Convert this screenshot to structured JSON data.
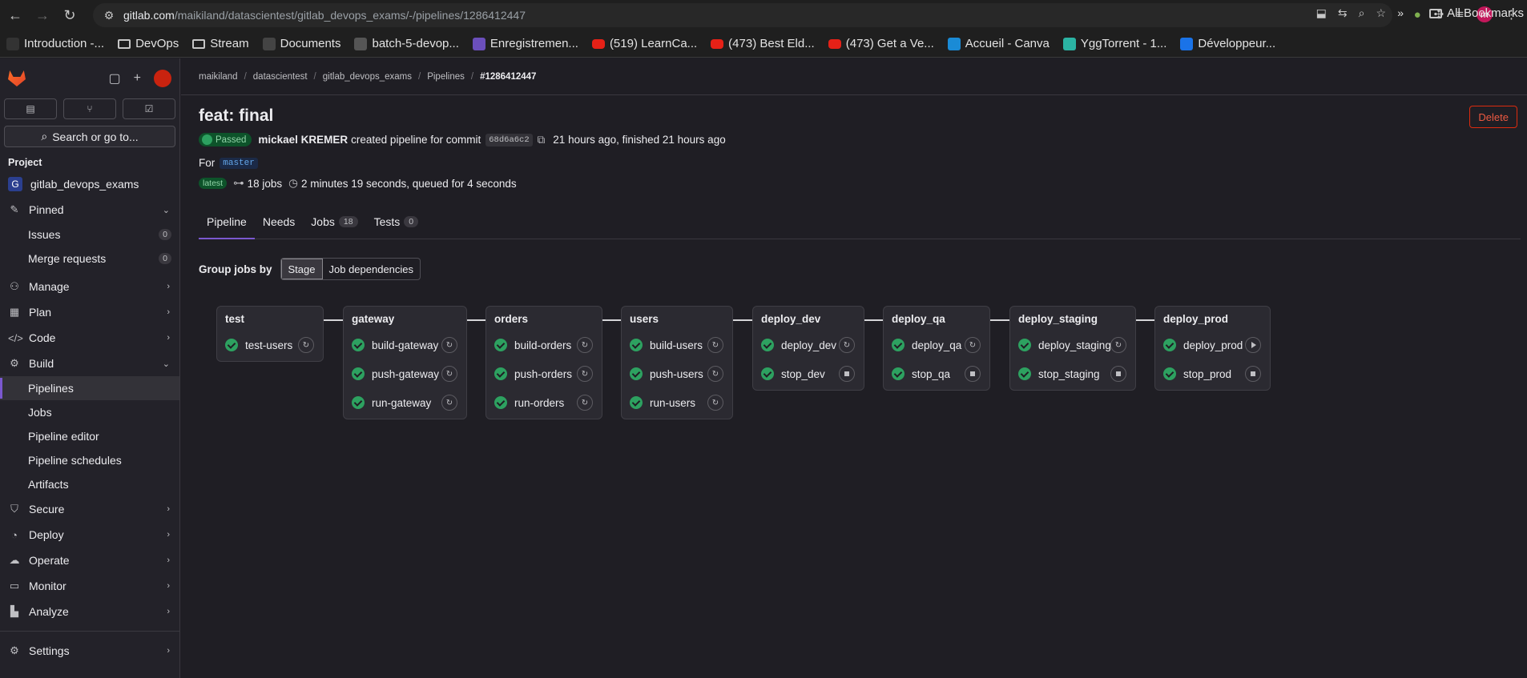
{
  "browser": {
    "url_host": "gitlab.com",
    "url_path": "/maikiland/datascientest/gitlab_devops_exams/-/pipelines/1286412447",
    "bookmarks": [
      {
        "label": "Introduction -...",
        "type": "site",
        "color": "#333333"
      },
      {
        "label": "DevOps",
        "type": "folder"
      },
      {
        "label": "Stream",
        "type": "folder"
      },
      {
        "label": "Documents",
        "type": "site",
        "color": "#444444"
      },
      {
        "label": "batch-5-devop...",
        "type": "site",
        "color": "#555555"
      },
      {
        "label": "Enregistremen...",
        "type": "site",
        "color": "#6b4fbb"
      },
      {
        "label": "(519) LearnCa...",
        "type": "youtube"
      },
      {
        "label": "(473) Best Eld...",
        "type": "youtube"
      },
      {
        "label": "(473) Get a Ve...",
        "type": "youtube"
      },
      {
        "label": "Accueil - Canva",
        "type": "site",
        "color": "#1a8bd6"
      },
      {
        "label": "YggTorrent - 1...",
        "type": "site",
        "color": "#2bb3a3"
      },
      {
        "label": "Développeur...",
        "type": "site",
        "color": "#1a73e8"
      }
    ],
    "more_label": "»",
    "all_bookmarks": "All Bookmarks",
    "profile_initial": "m"
  },
  "sidebar": {
    "search_label": "Search or go to...",
    "section_project": "Project",
    "project_name": "gitlab_devops_exams",
    "project_initial": "G",
    "pinned_label": "Pinned",
    "pinned_items": [
      {
        "label": "Issues",
        "count": "0"
      },
      {
        "label": "Merge requests",
        "count": "0"
      }
    ],
    "nav": [
      {
        "label": "Manage",
        "icon": "users-icon"
      },
      {
        "label": "Plan",
        "icon": "calendar-icon"
      },
      {
        "label": "Code",
        "icon": "code-icon"
      },
      {
        "label": "Build",
        "icon": "rocket-icon"
      }
    ],
    "build_items": [
      "Pipelines",
      "Jobs",
      "Pipeline editor",
      "Pipeline schedules",
      "Artifacts"
    ],
    "nav2": [
      {
        "label": "Secure",
        "icon": "shield-icon"
      },
      {
        "label": "Deploy",
        "icon": "deploy-icon"
      },
      {
        "label": "Operate",
        "icon": "cloud-icon"
      },
      {
        "label": "Monitor",
        "icon": "monitor-icon"
      },
      {
        "label": "Analyze",
        "icon": "chart-icon"
      }
    ],
    "settings_label": "Settings"
  },
  "breadcrumb": [
    "maikiland",
    "datascientest",
    "gitlab_devops_exams",
    "Pipelines",
    "#1286412447"
  ],
  "pipeline": {
    "title": "feat: final",
    "delete_label": "Delete",
    "status": "Passed",
    "author": "mickael KREMER",
    "created_text": "created pipeline for commit",
    "commit": "68d6a6c2",
    "time_text": "21 hours ago, finished 21 hours ago",
    "for_label": "For",
    "branch": "master",
    "latest_badge": "latest",
    "jobs_text": "18 jobs",
    "duration_text": "2 minutes 19 seconds, queued for 4 seconds"
  },
  "tabs": [
    {
      "label": "Pipeline",
      "count": ""
    },
    {
      "label": "Needs",
      "count": ""
    },
    {
      "label": "Jobs",
      "count": "18"
    },
    {
      "label": "Tests",
      "count": "0"
    }
  ],
  "group_by": {
    "label": "Group jobs by",
    "options": [
      "Stage",
      "Job dependencies"
    ],
    "selected": "Stage"
  },
  "stages": [
    {
      "name": "test",
      "jobs": [
        {
          "name": "test-users",
          "action": "retry"
        }
      ]
    },
    {
      "name": "gateway",
      "jobs": [
        {
          "name": "build-gateway",
          "action": "retry"
        },
        {
          "name": "push-gateway",
          "action": "retry"
        },
        {
          "name": "run-gateway",
          "action": "retry"
        }
      ]
    },
    {
      "name": "orders",
      "jobs": [
        {
          "name": "build-orders",
          "action": "retry"
        },
        {
          "name": "push-orders",
          "action": "retry"
        },
        {
          "name": "run-orders",
          "action": "retry"
        }
      ]
    },
    {
      "name": "users",
      "jobs": [
        {
          "name": "build-users",
          "action": "retry"
        },
        {
          "name": "push-users",
          "action": "retry"
        },
        {
          "name": "run-users",
          "action": "retry"
        }
      ]
    },
    {
      "name": "deploy_dev",
      "jobs": [
        {
          "name": "deploy_dev",
          "action": "retry"
        },
        {
          "name": "stop_dev",
          "action": "stop"
        }
      ]
    },
    {
      "name": "deploy_qa",
      "jobs": [
        {
          "name": "deploy_qa",
          "action": "retry"
        },
        {
          "name": "stop_qa",
          "action": "stop"
        }
      ]
    },
    {
      "name": "deploy_staging",
      "jobs": [
        {
          "name": "deploy_staging",
          "action": "retry"
        },
        {
          "name": "stop_staging",
          "action": "stop"
        }
      ]
    },
    {
      "name": "deploy_prod",
      "jobs": [
        {
          "name": "deploy_prod",
          "action": "play"
        },
        {
          "name": "stop_prod",
          "action": "stop"
        }
      ]
    }
  ]
}
